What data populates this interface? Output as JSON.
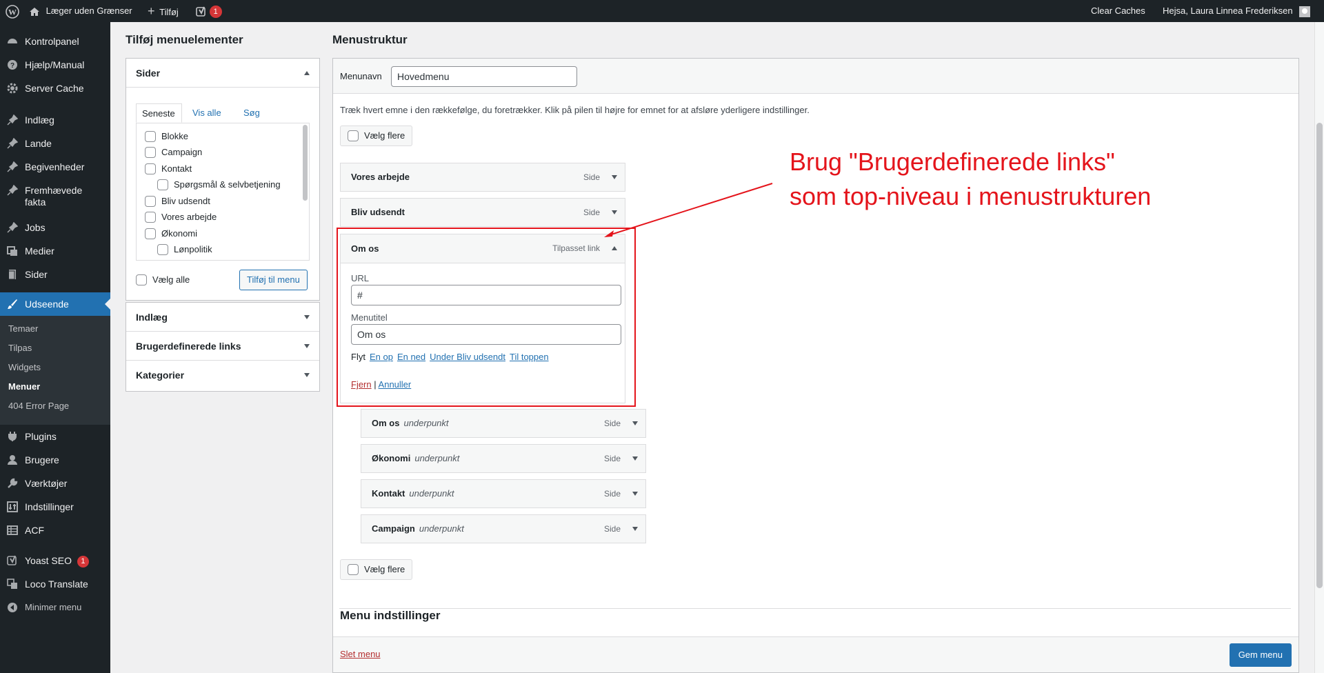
{
  "adminbar": {
    "site_name": "Læger uden Grænser",
    "new_label": "Tilføj",
    "yoast_count": "1",
    "clear_caches": "Clear Caches",
    "greeting": "Hejsa, Laura Linnea Frederiksen"
  },
  "sidebar": {
    "items": [
      {
        "label": "Kontrolpanel",
        "icon": "dashboard-icon"
      },
      {
        "label": "Hjælp/Manual",
        "icon": "help-icon"
      },
      {
        "label": "Server Cache",
        "icon": "gear-icon"
      },
      {
        "label": "Indlæg",
        "icon": "pin-icon"
      },
      {
        "label": "Lande",
        "icon": "pin-icon"
      },
      {
        "label": "Begivenheder",
        "icon": "pin-icon"
      },
      {
        "label": "Fremhævede fakta",
        "icon": "pin-icon"
      },
      {
        "label": "Jobs",
        "icon": "pin-icon"
      },
      {
        "label": "Medier",
        "icon": "media-icon"
      },
      {
        "label": "Sider",
        "icon": "pages-icon"
      },
      {
        "label": "Udseende",
        "icon": "brush-icon"
      },
      {
        "label": "Plugins",
        "icon": "plug-icon"
      },
      {
        "label": "Brugere",
        "icon": "user-icon"
      },
      {
        "label": "Værktøjer",
        "icon": "wrench-icon"
      },
      {
        "label": "Indstillinger",
        "icon": "settings-icon"
      },
      {
        "label": "ACF",
        "icon": "table-icon"
      },
      {
        "label": "Yoast SEO",
        "icon": "yoast-icon",
        "badge": "1"
      },
      {
        "label": "Loco Translate",
        "icon": "translate-icon"
      },
      {
        "label": "Minimer menu",
        "icon": "collapse-icon"
      }
    ],
    "submenu": [
      "Temaer",
      "Tilpas",
      "Widgets",
      "Menuer",
      "404 Error Page"
    ]
  },
  "left": {
    "title": "Tilføj menuelementer",
    "pages_heading": "Sider",
    "tabs": [
      "Seneste",
      "Vis alle",
      "Søg"
    ],
    "pages": [
      {
        "label": "Blokke",
        "indent": 0
      },
      {
        "label": "Campaign",
        "indent": 0
      },
      {
        "label": "Kontakt",
        "indent": 0
      },
      {
        "label": "Spørgsmål & selvbetjening",
        "indent": 1
      },
      {
        "label": "Bliv udsendt",
        "indent": 0
      },
      {
        "label": "Vores arbejde",
        "indent": 0
      },
      {
        "label": "Økonomi",
        "indent": 0
      },
      {
        "label": "Lønpolitik",
        "indent": 1
      }
    ],
    "select_all": "Vælg alle",
    "add_button": "Tilføj til menu",
    "sections": [
      "Indlæg",
      "Brugerdefinerede links",
      "Kategorier"
    ]
  },
  "main": {
    "title": "Menustruktur",
    "menu_name_label": "Menunavn",
    "menu_name_value": "Hovedmenu",
    "instructions": "Træk hvert emne i den rækkefølge, du foretrækker. Klik på pilen til højre for emnet for at afsløre yderligere indstillinger.",
    "select_multiple": "Vælg flere",
    "items_top": [
      {
        "title": "Vores arbejde",
        "type": "Side"
      },
      {
        "title": "Bliv udsendt",
        "type": "Side"
      }
    ],
    "open_item": {
      "title": "Om os",
      "type": "Tilpasset link",
      "url_label": "URL",
      "url_value": "#",
      "menutitle_label": "Menutitel",
      "menutitle_value": "Om os",
      "move_label": "Flyt",
      "move_links": [
        "En op",
        "En ned",
        "Under Bliv udsendt",
        "Til toppen"
      ],
      "remove": "Fjern",
      "separator": "|",
      "cancel": "Annuller"
    },
    "sub_items": [
      {
        "title": "Om os",
        "sub": "underpunkt",
        "type": "Side"
      },
      {
        "title": "Økonomi",
        "sub": "underpunkt",
        "type": "Side"
      },
      {
        "title": "Kontakt",
        "sub": "underpunkt",
        "type": "Side"
      },
      {
        "title": "Campaign",
        "sub": "underpunkt",
        "type": "Side"
      }
    ],
    "select_multiple_bottom": "Vælg flere",
    "settings_heading": "Menu indstillinger",
    "delete_menu": "Slet menu",
    "save_menu": "Gem menu"
  },
  "annotation": {
    "line1": "Brug \"Brugerdefinerede links\"",
    "line2": "som top-niveau i menustrukturen",
    "color": "#e4141b"
  }
}
